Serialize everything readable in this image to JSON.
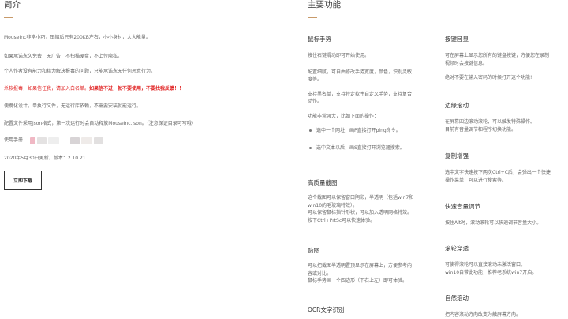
{
  "intro": {
    "title": "简介",
    "line1": "MouseInc非常小巧，压缩后只有200KB左右，小小身材，大大能量。",
    "line2": "如果承诺永久免费，无广告，不扫描硬盘，不上传隐私。",
    "line3": "个人作者没有能力和精力解决报毒的问题，只能承诺永无任何恶意行为。",
    "warning_a": "杀软报毒，如果信任我，请加入白名单。",
    "warning_b": "如果信不过，就不要使用，不要找我反馈！！！",
    "line5": "便携化设计，单执行文件，无运行库依赖，不需要安装就能运行。",
    "line6": "配置文件采用json格式，第一次运行时会自动释放MouseInc.json。（注意保证目录可写哦）",
    "manual_label": "使用手册",
    "update_info": "2020年5月30日更新，版本：2.10.21",
    "download_button": "立即下载",
    "redacted_colors": [
      "#f0b8c4",
      "#e4e2e2",
      "#eeeeee",
      "#d8d4d6",
      "#efebe9",
      "#e2e0e0"
    ]
  },
  "features": {
    "title": "主要功能",
    "accent_color": "#c89a6a",
    "left": {
      "gesture": {
        "title": "鼠标手势",
        "lines": [
          "按住右键滑动即可开始使用。",
          "配置细腻，可自由修改手势宽度，颜色，识别灵敏",
          "度等。",
          "支持黑名单，支持特定软件自定义手势，支持复合",
          "动作。",
          "功能非常强大，比如下面的操作："
        ],
        "bullets": [
          "选中一个网址，画P直接打开ping命令。",
          "选中文本以后，画S直接打开浏览器搜索。"
        ]
      },
      "screenshot": {
        "title": "高质量截图",
        "lines": [
          "这个截图可以保留窗口阴影，半透明（包括win7和",
          "win10的毛玻璃特效）。",
          "可以保留鼠标指针形状，可以加入透明网格特效。",
          "按下Ctrl+PrtSc可以快速体验。"
        ]
      },
      "sticker": {
        "title": "贴图",
        "lines": [
          "可以把截图半透明置顶显示在屏幕上，方便参考内",
          "容或对比。",
          "鼠标手势画一个四边形（下右上左）即可体验。"
        ]
      },
      "ocr": {
        "title": "OCR文字识别"
      }
    },
    "right": {
      "key_echo": {
        "title": "按键回显",
        "lines": [
          "可在屏幕上显示您所有的键盘按键，方便您在录制",
          "视频时会按键信息。",
          "绝对不要在输入密码的时候打开这个功能!"
        ]
      },
      "edge_scroll": {
        "title": "边缘滚动",
        "lines": [
          "在屏幕四边滚动滚轮，可以触发特殊操作。",
          "目前有音量调节和程序切换功能。"
        ]
      },
      "copy_enhance": {
        "title": "复制增强",
        "lines": [
          "选中文字快速按下两次Ctrl+C后，会弹出一个快捷",
          "操作菜单，可以进行搜索等。"
        ]
      },
      "volume": {
        "title": "快速音量调节",
        "lines": [
          "按住Alt时，滚动滚轮可以快速调节音量大小。"
        ]
      },
      "wheel": {
        "title": "滚轮穿透",
        "lines": [
          "可使得滚轮可以直接滚动未激活窗口。",
          "win10自带此功能，推荐老系统win7开启。"
        ]
      },
      "natural": {
        "title": "自然滚动",
        "lines": [
          "把内容滚动方向改变为触屏幕方向。"
        ]
      }
    }
  }
}
